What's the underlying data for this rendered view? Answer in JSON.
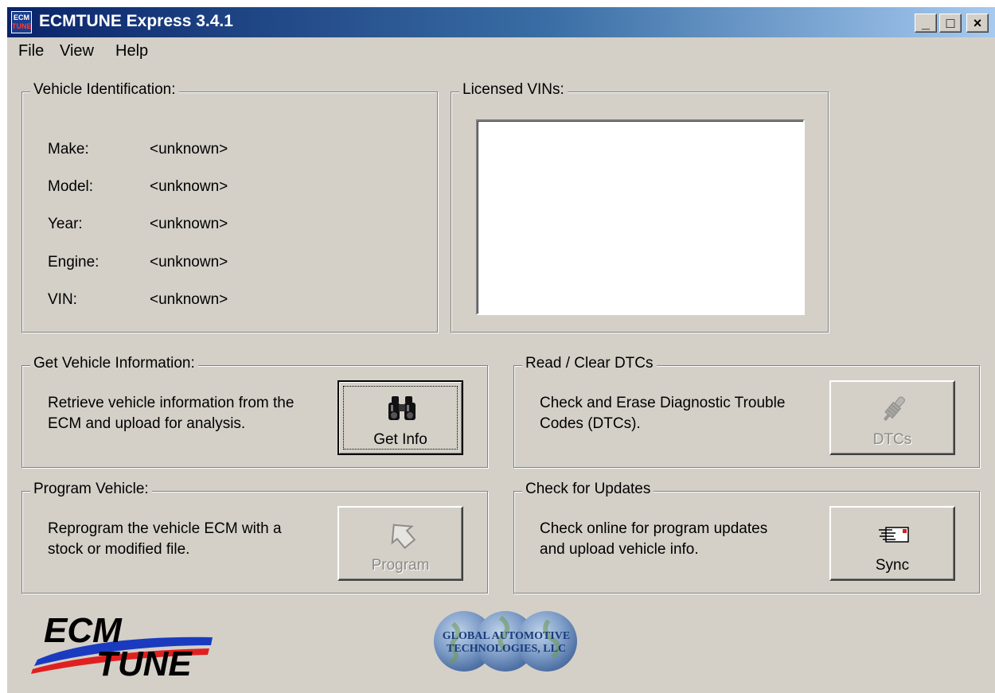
{
  "window": {
    "title": "ECMTUNE Express 3.4.1",
    "icon_text_top": "ECM",
    "icon_text_bottom": "TUNE"
  },
  "controls": {
    "minimize": "_",
    "maximize": "□",
    "close": "×"
  },
  "menu": {
    "file": "File",
    "view": "View",
    "help": "Help"
  },
  "vehicle_identification": {
    "title": "Vehicle Identification:",
    "fields": [
      {
        "label": "Make:",
        "value": "<unknown>"
      },
      {
        "label": "Model:",
        "value": "<unknown>"
      },
      {
        "label": "Year:",
        "value": "<unknown>"
      },
      {
        "label": "Engine:",
        "value": "<unknown>"
      },
      {
        "label": "VIN:",
        "value": "<unknown>"
      }
    ]
  },
  "licensed_vins": {
    "title": "Licensed VINs:",
    "items": []
  },
  "get_vehicle_info": {
    "title": "Get Vehicle Information:",
    "desc_line1": "Retrieve vehicle information from the",
    "desc_line2": "ECM and upload for analysis.",
    "button": "Get Info",
    "icon": "binoculars-icon"
  },
  "read_clear_dtcs": {
    "title": "Read / Clear DTCs",
    "desc_line1": "Check and Erase Diagnostic Trouble",
    "desc_line2": "Codes (DTCs).",
    "button": "DTCs",
    "icon": "probe-icon"
  },
  "program_vehicle": {
    "title": "Program Vehicle:",
    "desc_line1": "Reprogram the vehicle ECM with a",
    "desc_line2": "stock or modified file.",
    "button": "Program",
    "icon": "program-arrow-icon"
  },
  "check_updates": {
    "title": "Check for Updates",
    "desc_line1": "Check online for program updates",
    "desc_line2": "and upload vehicle info.",
    "button": "Sync",
    "icon": "email-icon"
  },
  "logos": {
    "ecmtune_line1": "ECM",
    "ecmtune_line2": "TUNE",
    "gat_line1": "GLOBAL AUTOMOTIVE",
    "gat_line2": "TECHNOLOGIES, LLC"
  },
  "colors": {
    "title_gradient_start": "#0a246a",
    "title_gradient_end": "#a6caf0",
    "window_bg": "#d4d0c8",
    "disabled_text": "#8c8a86",
    "logo_blue": "#1a3bbf",
    "logo_red": "#e02020"
  }
}
